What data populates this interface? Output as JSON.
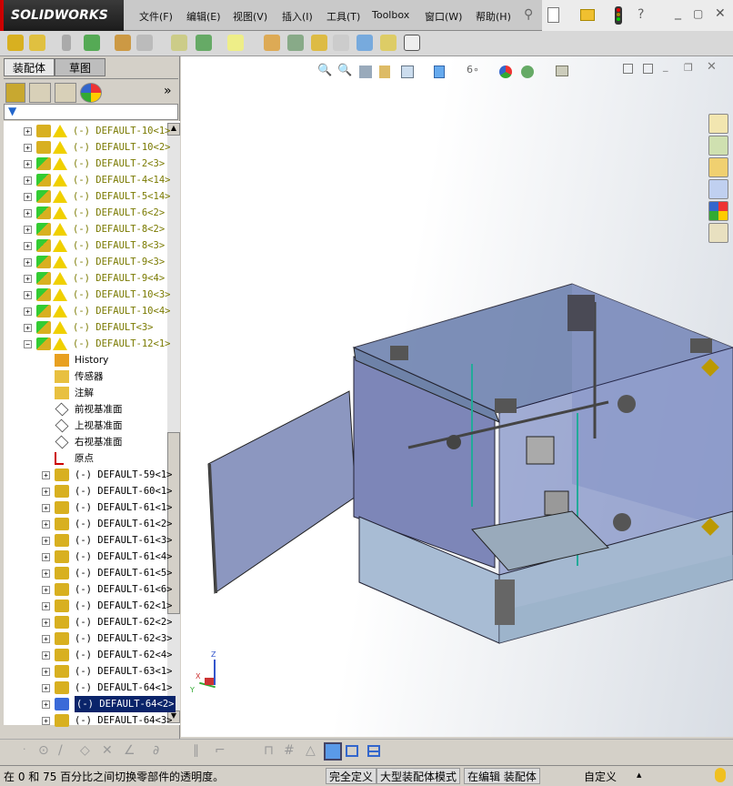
{
  "app": {
    "logo": "SOLIDWORKS"
  },
  "menu": [
    "文件(F)",
    "编辑(E)",
    "视图(V)",
    "插入(I)",
    "工具(T)",
    "Toolbox",
    "窗口(W)",
    "帮助(H)"
  ],
  "panel": {
    "tabs": [
      "装配体",
      "草图"
    ],
    "more": "»"
  },
  "tree": {
    "warn_rows": [
      "(-) DEFAULT-10<1>",
      "(-) DEFAULT-10<2>",
      "(-) DEFAULT-2<3>",
      "(-) DEFAULT-4<14>",
      "(-) DEFAULT-5<14>",
      "(-) DEFAULT-6<2>",
      "(-) DEFAULT-8<2>",
      "(-) DEFAULT-8<3>",
      "(-) DEFAULT-9<3>",
      "(-) DEFAULT-9<4>",
      "(-) DEFAULT-10<3>",
      "(-) DEFAULT-10<4>",
      "(-) DEFAULT<3>",
      "(-) DEFAULT-12<1>"
    ],
    "features": [
      "History",
      "传感器",
      "注解",
      "前视基准面",
      "上视基准面",
      "右视基准面",
      "原点"
    ],
    "parts": [
      "(-) DEFAULT-59<1>",
      "(-) DEFAULT-60<1>",
      "(-) DEFAULT-61<1>",
      "(-) DEFAULT-61<2>",
      "(-) DEFAULT-61<3>",
      "(-) DEFAULT-61<4>",
      "(-) DEFAULT-61<5>",
      "(-) DEFAULT-61<6>",
      "(-) DEFAULT-62<1>",
      "(-) DEFAULT-62<2>",
      "(-) DEFAULT-62<3>",
      "(-) DEFAULT-62<4>",
      "(-) DEFAULT-63<1>",
      "(-) DEFAULT-64<1>",
      "(-) DEFAULT-64<2>",
      "(-) DEFAULT-64<3>"
    ],
    "selected": "(-) DEFAULT-64<2>"
  },
  "triad": {
    "x": "X",
    "y": "Y",
    "z": "Z"
  },
  "status": {
    "message": "在 0 和 75 百分比之间切换零部件的透明度。",
    "state": "完全定义",
    "mode": "大型装配体模式",
    "editing": "在编辑 装配体",
    "units": "自定义",
    "units_arrow": "▲"
  }
}
